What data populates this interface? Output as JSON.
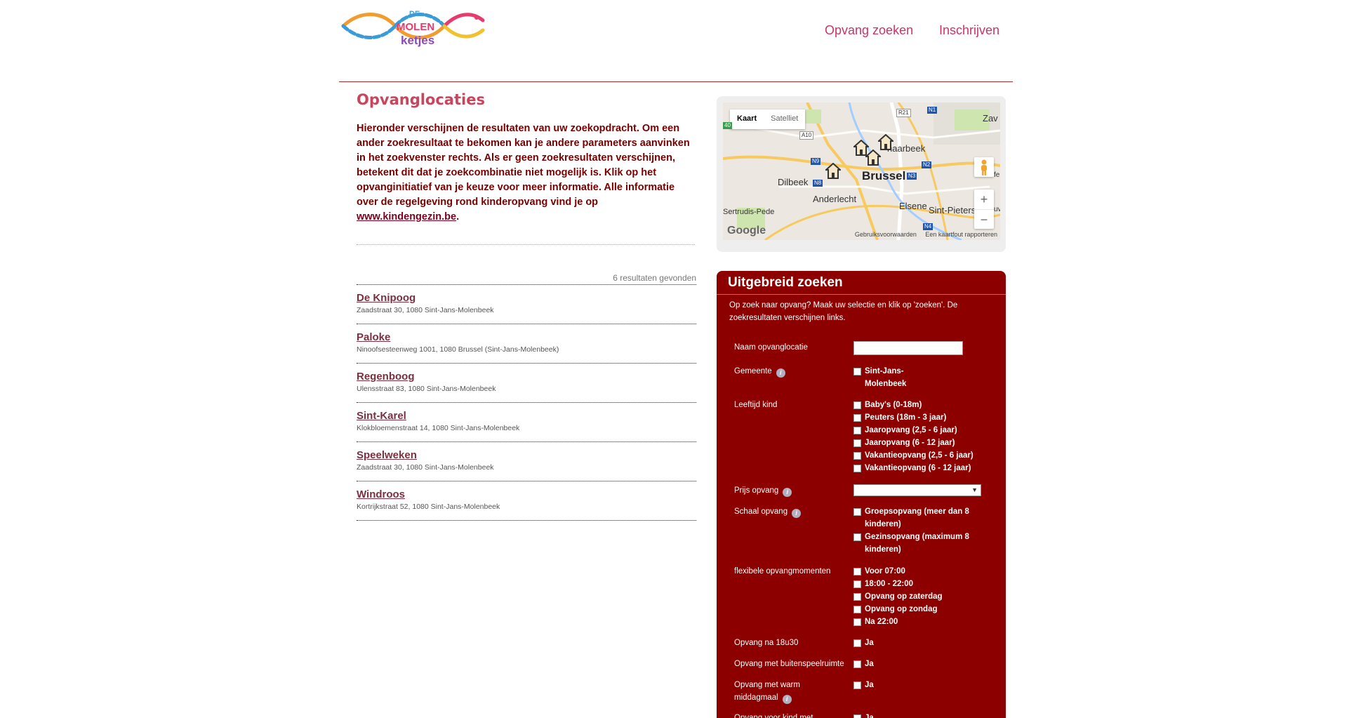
{
  "header": {
    "logo_alt": "De Molenketjes",
    "logo_text": {
      "de": "DE",
      "molen": "MOLEN",
      "ketjes": "ketjes"
    },
    "nav": {
      "search": "Opvang zoeken",
      "register": "Inschrijven"
    }
  },
  "main": {
    "title": "Opvanglocaties",
    "intro": "Hieronder verschijnen de resultaten van uw zoekopdracht. Om een ander zoekresultaat te bekomen kan je andere parameters aanvinken in het zoekvenster rechts. Als er geen zoekresultaten verschijnen, betekent dit dat je zoekcombinatie niet mogelijk is. Klik op het opvanginitiatief van je keuze voor meer informatie. Alle informatie over de regelgeving rond kinderopvang vind je op ",
    "intro_link": "www.kindengezin.be",
    "intro_end": ".",
    "results_count": "6 resultaten gevonden",
    "results": [
      {
        "name": "De Knipoog",
        "address": "Zaadstraat 30, 1080 Sint-Jans-Molenbeek"
      },
      {
        "name": "Paloke",
        "address": "Ninoofsesteenweg 1001, 1080 Brussel (Sint-Jans-Molenbeek)"
      },
      {
        "name": "Regenboog",
        "address": "Ulensstraat 83, 1080 Sint-Jans-Molenbeek"
      },
      {
        "name": "Sint-Karel",
        "address": "Klokbloemenstraat 14, 1080 Sint-Jans-Molenbeek"
      },
      {
        "name": "Speelweken",
        "address": "Zaadstraat 30, 1080 Sint-Jans-Molenbeek"
      },
      {
        "name": "Windroos",
        "address": "Kortrijkstraat 52, 1080 Sint-Jans-Molenbeek"
      }
    ]
  },
  "map": {
    "tabs": {
      "map": "Kaart",
      "satellite": "Satelliet"
    },
    "labels": {
      "brussel": "Brussel",
      "anderlecht": "Anderlecht",
      "dilbeek": "Dilbeek",
      "elsene": "Elsene",
      "schaarbeek": "haarbeek",
      "sint_pieters": "Sint-Pieters",
      "gertrudis": "Sertrudis-Pede",
      "zav": "Zav",
      "fe": "fe",
      "uv": "uv"
    },
    "roads": {
      "r21": "R21",
      "n1": "N1",
      "a10": "A10",
      "n9": "N9",
      "n8": "N8",
      "n2": "N2",
      "n3": "N3",
      "n4": "N4",
      "forty": "40"
    },
    "zoom_in": "+",
    "zoom_out": "−",
    "google": "Google",
    "terms": "Gebruiksvoorwaarden",
    "report": "Een kaartfout rapporteren",
    "colors": {
      "marker": "#f5e6c8",
      "highway": "#f7c95e",
      "water": "#a3ccff",
      "park": "#cfe5b0"
    }
  },
  "search": {
    "title": "Uitgebreid zoeken",
    "intro": "Op zoek naar opvang? Maak uw selectie en klik op 'zoeken'. De zoekresultaten verschijnen links.",
    "name_label": "Naam opvanglocatie",
    "name_value": "",
    "municipality_label": "Gemeente",
    "municipality_options": [
      "Sint-Jans-Molenbeek"
    ],
    "age_label": "Leeftijd kind",
    "age_options": [
      "Baby's (0-18m)",
      "Peuters (18m - 3 jaar)",
      "Jaaropvang (2,5 - 6 jaar)",
      "Jaaropvang (6 - 12 jaar)",
      "Vakantieopvang (2,5 - 6 jaar)",
      "Vakantieopvang (6 - 12 jaar)"
    ],
    "price_label": "Prijs opvang",
    "price_value": "",
    "scale_label": "Schaal opvang",
    "scale_options": [
      "Groepsopvang (meer dan 8 kinderen)",
      "Gezinsopvang (maximum 8 kinderen)"
    ],
    "flex_label": "flexibele opvangmomenten",
    "flex_options": [
      "Voor 07:00",
      "18:00 - 22:00",
      "Opvang op zaterdag",
      "Opvang op zondag",
      "Na 22:00"
    ],
    "after_label": "Opvang na 18u30",
    "outdoor_label": "Opvang met buitenspeelruimte",
    "meal_label": "Opvang met warm middagmaal",
    "special_label": "Opvang voor kind met",
    "yes": "Ja",
    "info_icon": "i",
    "select_arrow": "▼"
  },
  "colors": {
    "accent": "#cc3366",
    "panel_bg": "#8c0000",
    "title": "#c8455c",
    "intro_text": "#7a0000"
  }
}
